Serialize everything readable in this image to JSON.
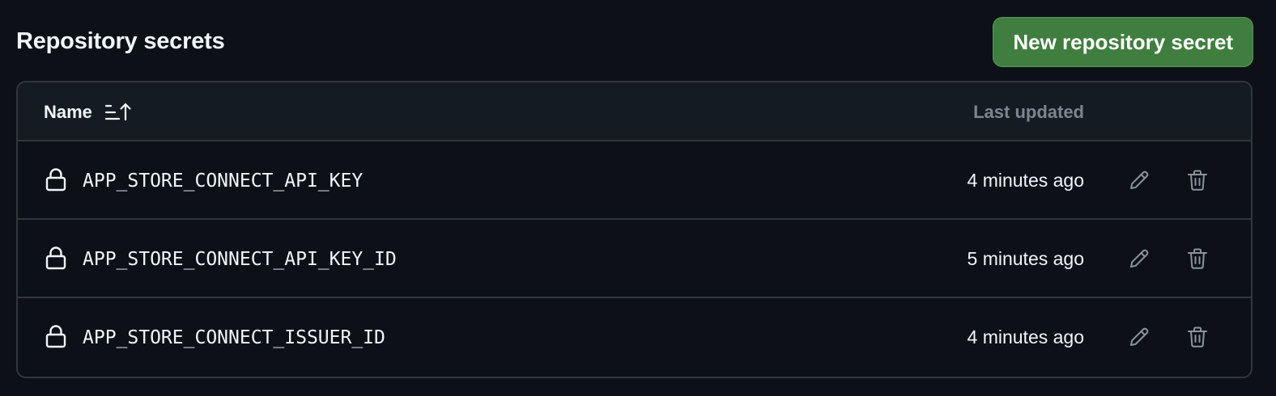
{
  "header": {
    "title": "Repository secrets",
    "new_button_label": "New repository secret"
  },
  "table": {
    "columns": {
      "name": "Name",
      "last_updated": "Last updated"
    },
    "rows": [
      {
        "name": "APP_STORE_CONNECT_API_KEY",
        "last_updated": "4 minutes ago"
      },
      {
        "name": "APP_STORE_CONNECT_API_KEY_ID",
        "last_updated": "5 minutes ago"
      },
      {
        "name": "APP_STORE_CONNECT_ISSUER_ID",
        "last_updated": "4 minutes ago"
      }
    ]
  },
  "icons": {
    "sort": "sort-ascending-icon",
    "lock": "lock-icon",
    "edit": "pencil-icon",
    "delete": "trash-icon"
  },
  "colors": {
    "background": "#0d1117",
    "header_bg": "#151b23",
    "border": "#30363d",
    "primary_button": "#3f7e3f",
    "muted_text": "#7d8590",
    "text": "#f0f6fc"
  }
}
